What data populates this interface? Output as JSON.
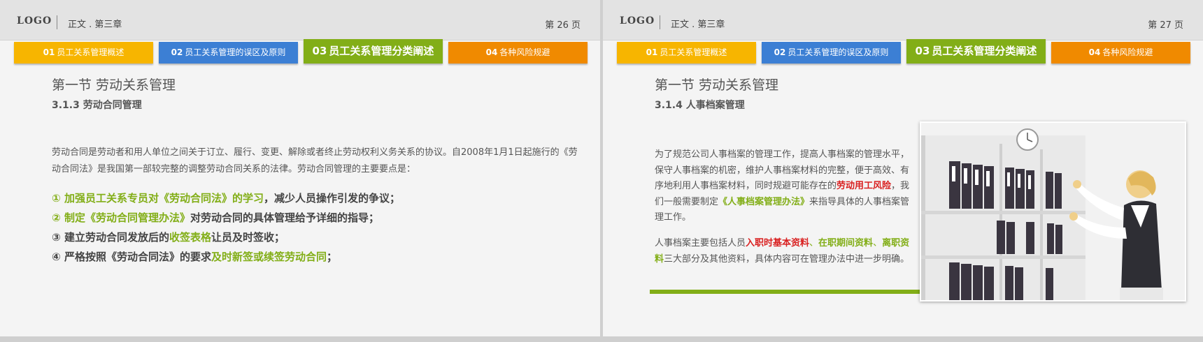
{
  "slides": [
    {
      "header": {
        "logo": "LOGO",
        "chapter": "正文 . 第三章",
        "page": "第 26 页"
      },
      "tabs": [
        {
          "num": "01",
          "label": "员工关系管理概述"
        },
        {
          "num": "02",
          "label": "员工关系管理的误区及原则"
        },
        {
          "num": "03",
          "label": "员工关系管理分类阐述"
        },
        {
          "num": "04",
          "label": "各种风险规避"
        }
      ],
      "section_title": "第一节  劳动关系管理",
      "subsection_title": "3.1.3 劳动合同管理",
      "paragraph": "劳动合同是劳动者和用人单位之间关于订立、履行、变更、解除或者终止劳动权利义务关系的协议。自2008年1月1日起施行的《劳动合同法》是我国第一部较完整的调整劳动合同关系的法律。劳动合同管理的主要要点是：",
      "items": [
        {
          "marker": "①",
          "a": "加强员工关系专员对《劳动合同法》的学习",
          "b": "，减少人员操作引发的争议；"
        },
        {
          "marker": "②",
          "a": "制定《劳动合同管理办法》",
          "b": "对劳动合同的具体管理给予详细的指导；"
        },
        {
          "marker": "③",
          "a": "建立劳动合同发放后的",
          "b": "收签表格",
          "c": "让员及时签收；"
        },
        {
          "marker": "④",
          "a": "严格按照《劳动合同法》的要求",
          "b": "及时新签或续签劳动合同",
          "c": "；"
        }
      ]
    },
    {
      "header": {
        "logo": "LOGO",
        "chapter": "正文 . 第三章",
        "page": "第 27 页"
      },
      "tabs": [
        {
          "num": "01",
          "label": "员工关系管理概述"
        },
        {
          "num": "02",
          "label": "员工关系管理的误区及原则"
        },
        {
          "num": "03",
          "label": "员工关系管理分类阐述"
        },
        {
          "num": "04",
          "label": "各种风险规避"
        }
      ],
      "section_title": "第一节  劳动关系管理",
      "subsection_title": "3.1.4 人事档案管理",
      "para1": {
        "pre": "为了规范公司人事档案的管理工作，提高人事档案的管理水平，保守人事档案的机密，维护人事档案材料的完整，便于高效、有序地利用人事档案材料，同时规避可能存在的",
        "red": "劳动用工风险",
        "mid": "，我们一般需要制定",
        "green": "《人事档案管理办法》",
        "post": "来指导具体的人事档案管理工作。"
      },
      "para2": {
        "pre": "人事档案主要包括人员",
        "r1": "入职时基本资料",
        "s1": "、",
        "g1": "在职期间资料",
        "s2": "、",
        "g2": "离职资料",
        "post": "三大部分及其他资料，具体内容可在管理办法中进一步明确。"
      }
    }
  ],
  "colors": {
    "tab1": "#f7b500",
    "tab2": "#3c7fd4",
    "tab3": "#82ae17",
    "tab4": "#f08a00",
    "accent_green": "#82ae17",
    "accent_red": "#d92020"
  }
}
